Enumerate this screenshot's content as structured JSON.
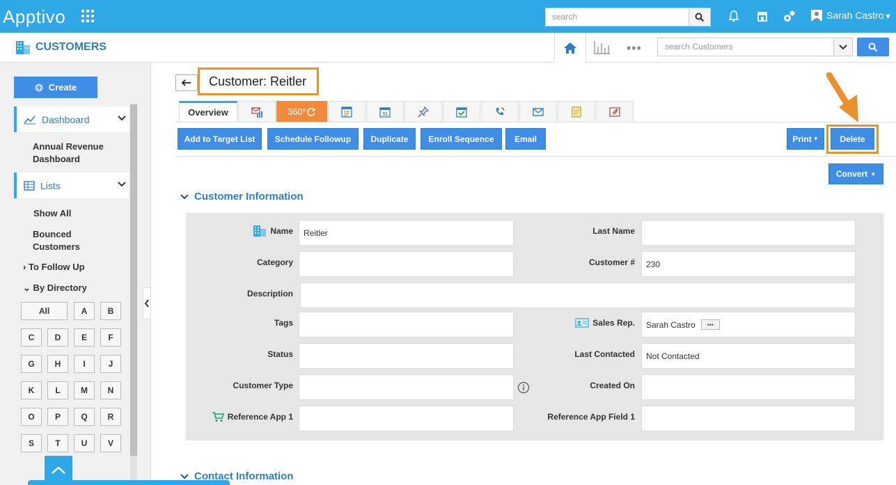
{
  "topbar": {
    "brand": "Apptivo",
    "search_placeholder": "search",
    "user_name": "Sarah Castro",
    "icons": [
      "apps-grid-icon",
      "search-icon",
      "bell-icon",
      "store-icon",
      "settings-cog-icon",
      "user-avatar-icon"
    ]
  },
  "subbar": {
    "app_title": "CUSTOMERS",
    "search_placeholder": "search Customers",
    "more_label": "•••"
  },
  "sidebar": {
    "create_label": "Create",
    "dashboard_label": "Dashboard",
    "annual_revenue_line1": "Annual Revenue",
    "annual_revenue_line2": "Dashboard",
    "lists_label": "Lists",
    "show_all": "Show All",
    "bounced_line1": "Bounced",
    "bounced_line2": "Customers",
    "to_follow_up": "To Follow Up",
    "by_directory": "By Directory",
    "alphabet": [
      "All",
      "A",
      "B",
      "C",
      "D",
      "E",
      "F",
      "G",
      "H",
      "I",
      "J",
      "K",
      "L",
      "M",
      "N",
      "O",
      "P",
      "Q",
      "R",
      "S",
      "T",
      "U",
      "V"
    ]
  },
  "header": {
    "title": "Customer: Reitler",
    "tab_overview": "Overview",
    "tab_360": "360°"
  },
  "actions": {
    "add_to_target_list": "Add to Target List",
    "schedule_followup": "Schedule Followup",
    "duplicate": "Duplicate",
    "enroll_sequence": "Enroll Sequence",
    "email": "Email",
    "print": "Print",
    "delete": "Delete",
    "convert": "Convert"
  },
  "customer_info": {
    "section_title": "Customer Information",
    "name_label": "Name",
    "name_value": "Reitler",
    "last_name_label": "Last Name",
    "last_name_value": "",
    "category_label": "Category",
    "category_value": "",
    "customer_no_label": "Customer #",
    "customer_no_value": "230",
    "description_label": "Description",
    "description_value": "",
    "tags_label": "Tags",
    "tags_value": "",
    "sales_rep_label": "Sales Rep.",
    "sales_rep_value": "Sarah Castro",
    "status_label": "Status",
    "status_value": "",
    "last_contacted_label": "Last Contacted",
    "last_contacted_value": "Not Contacted",
    "customer_type_label": "Customer Type",
    "customer_type_value": "",
    "created_on_label": "Created On",
    "created_on_value": "",
    "ref_app_label": "Reference App 1",
    "ref_app_value": "",
    "ref_field_label": "Reference App Field 1",
    "ref_field_value": ""
  },
  "contact_info": {
    "section_title": "Contact Information"
  },
  "colors": {
    "topbar": "#2fa8e8",
    "button": "#3e8ee8",
    "highlight": "#e8912d",
    "tab_360": "#f5893a"
  }
}
